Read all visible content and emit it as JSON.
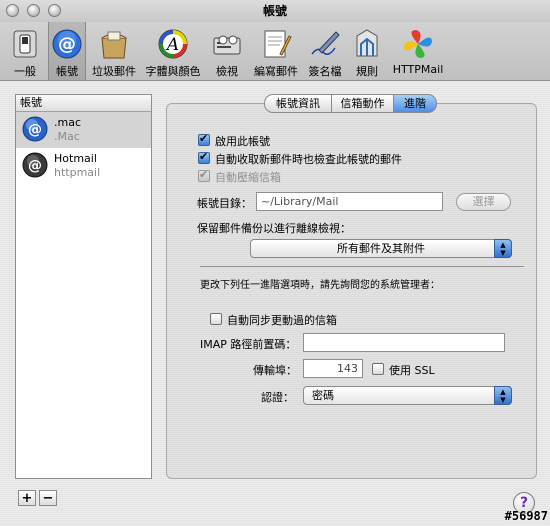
{
  "window": {
    "title": "帳號"
  },
  "toolbar": {
    "items": [
      {
        "label": "一般",
        "icon": "switch-icon"
      },
      {
        "label": "帳號",
        "icon": "at-sign-icon"
      },
      {
        "label": "垃圾郵件",
        "icon": "junk-mail-icon"
      },
      {
        "label": "字體與顏色",
        "icon": "font-icon"
      },
      {
        "label": "檢視",
        "icon": "view-icon"
      },
      {
        "label": "編寫郵件",
        "icon": "compose-icon"
      },
      {
        "label": "簽名檔",
        "icon": "signature-pen-icon"
      },
      {
        "label": "規則",
        "icon": "rules-icon"
      },
      {
        "label": "HTTPMail",
        "icon": "httpmail-icon"
      }
    ],
    "selected": "帳號"
  },
  "sidebar": {
    "header": "帳號",
    "accounts": [
      {
        "name": ".mac",
        "type": ".Mac",
        "selected": true
      },
      {
        "name": "Hotmail",
        "type": "httpmail",
        "selected": false
      }
    ],
    "add_label": "+",
    "remove_label": "−"
  },
  "tabs": [
    {
      "label": "帳號資訊",
      "selected": false
    },
    {
      "label": "信箱動作",
      "selected": false
    },
    {
      "label": "進階",
      "selected": true
    }
  ],
  "advanced": {
    "enable_account": {
      "label": "啟用此帳號",
      "checked": true
    },
    "auto_check": {
      "label": "自動收取新郵件時也檢查此帳號的郵件",
      "checked": true
    },
    "compact": {
      "label": "自動壓縮信箱",
      "checked": true,
      "disabled": true
    },
    "account_dir_label": "帳號目錄：",
    "account_dir_value": "~/Library/Mail",
    "choose_button": "選擇",
    "keep_copies_label": "保留郵件備份以進行離線檢視：",
    "keep_copies_value": "所有郵件及其附件",
    "admin_note": "更改下列任一進階選項時，請先詢問您的系統管理者：",
    "sync_mailboxes": {
      "label": "自動同步更動過的信箱",
      "checked": false
    },
    "imap_prefix_label": "IMAP 路徑前置碼：",
    "imap_prefix_value": "",
    "port_label": "傳輸埠：",
    "port_value": "143",
    "ssl": {
      "label": "使用 SSL",
      "checked": false
    },
    "auth_label": "認證：",
    "auth_value": "密碼"
  },
  "help_label": "?",
  "watermark": "#56987"
}
